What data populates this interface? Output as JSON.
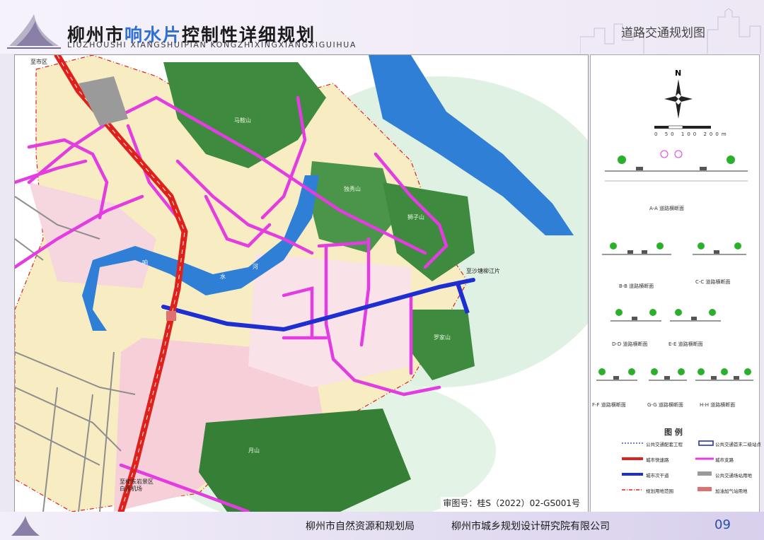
{
  "header": {
    "title_a": "柳州市",
    "title_b": "响水片",
    "title_c": "控制性详细规划",
    "subtitle": "LIUZHOUSHI  XIANGSHUIPIAN  KONGZHIXINGXIANGXIGUIHUA",
    "sheet_title": "道路交通规划图"
  },
  "map": {
    "labels": {
      "district": "至市区",
      "to_liujiang": "至沙塘柳江片",
      "tourism": "至柳东岩景区\n白莲机场",
      "hill_1": "马鞍山",
      "hill_2": "独秀山",
      "hill_3": "狮子山",
      "hill_4": "罗家山",
      "hill_5": "月山",
      "river_1": "响",
      "river_2": "水",
      "river_3": "河"
    },
    "review_no": "审图号：桂S（2022）02-GS001号"
  },
  "side": {
    "north": "N",
    "scale": [
      "0",
      "50",
      "100",
      "200m"
    ],
    "sections": [
      {
        "id": "A-A",
        "label": "A-A  道路横断面"
      },
      {
        "id": "B-B",
        "label": "B-B  道路横断面"
      },
      {
        "id": "C-C",
        "label": "C-C  道路横断面"
      },
      {
        "id": "D-D",
        "label": "D-D  道路横断面"
      },
      {
        "id": "E-E",
        "label": "E-E  道路横断面"
      },
      {
        "id": "F-F",
        "label": "F-F  道路横断面"
      },
      {
        "id": "G-G",
        "label": "G-G  道路横断面"
      },
      {
        "id": "H-H",
        "label": "H-H  道路横断面"
      }
    ],
    "legend_title": "图 例",
    "legend": [
      {
        "label": "公共交通配套工程",
        "color": "#4455cc",
        "style": "dash"
      },
      {
        "label": "公共交通首末二级站点",
        "color": "#2233bb",
        "style": "box"
      },
      {
        "label": "城市快速路",
        "color": "#e0201a",
        "style": "solid"
      },
      {
        "label": "城市支路",
        "color": "#e33ce0",
        "style": "solid"
      },
      {
        "label": "城市次干道",
        "color": "#1d2fd1",
        "style": "solid"
      },
      {
        "label": "公共交通场站用地",
        "color": "#9a9a9a",
        "style": "fill"
      },
      {
        "label": "规划用地范围",
        "color": "#e0201a",
        "style": "dashdot"
      },
      {
        "label": "加油加气站用地",
        "color": "#e07070",
        "style": "fill"
      }
    ]
  },
  "footer": {
    "org1": "柳州市自然资源和规划局",
    "org2": "柳州市城乡规划设计研究院有限公司",
    "page": "09"
  },
  "colors": {
    "expressway": "#e0201a",
    "secondary": "#1d2fd1",
    "branch": "#e33ce0",
    "water": "#2f7fd6",
    "hill": "#3e8a3e",
    "residential": "#f7ecc2",
    "commercial": "#f6cfd9"
  }
}
